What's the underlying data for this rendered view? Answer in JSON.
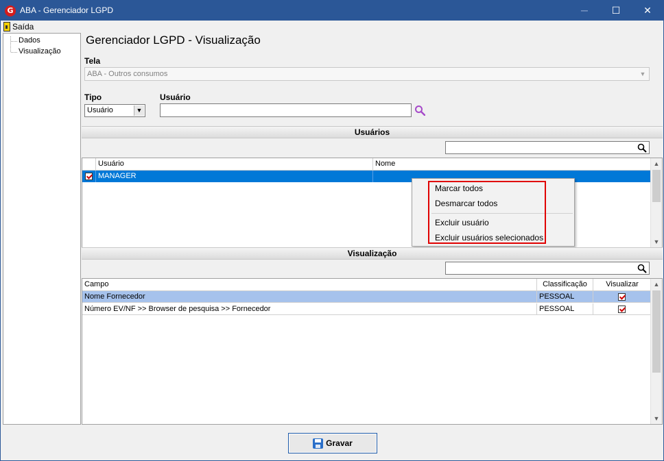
{
  "window": {
    "title": "ABA - Gerenciador LGPD",
    "app_icon_letter": "G",
    "min_glyph": "─",
    "max_glyph": "☐",
    "close_glyph": "✕"
  },
  "menu": {
    "exit_label": "Saída"
  },
  "tree": {
    "items": [
      {
        "label": "Dados"
      },
      {
        "label": "Visualização"
      }
    ]
  },
  "page": {
    "title": "Gerenciador LGPD - Visualização"
  },
  "form": {
    "tela_label": "Tela",
    "tela_value": "ABA - Outros consumos",
    "tipo_label": "Tipo",
    "tipo_value": "Usuário",
    "usuario_label": "Usuário",
    "usuario_value": ""
  },
  "users_section": {
    "header": "Usuários",
    "filter_value": "",
    "columns": [
      "",
      "Usuário",
      "Nome"
    ],
    "rows": [
      {
        "checked": true,
        "usuario": "MANAGER",
        "nome": ""
      }
    ]
  },
  "context_menu": {
    "items": [
      {
        "label": "Marcar todos"
      },
      {
        "label": "Desmarcar todos"
      },
      {
        "label": "Excluir usuário"
      },
      {
        "label": "Excluir usuários selecionados"
      }
    ],
    "highlight_color": "#e00000"
  },
  "view_section": {
    "header": "Visualização",
    "filter_value": "",
    "columns": [
      "Campo",
      "Classificação",
      "Visualizar"
    ],
    "rows": [
      {
        "campo": "Nome Fornecedor",
        "classificacao": "PESSOAL",
        "visualizar": true
      },
      {
        "campo": "Número  EV/NF >> Browser de pesquisa >> Fornecedor",
        "classificacao": "PESSOAL",
        "visualizar": true
      }
    ]
  },
  "footer": {
    "save_label": "Gravar"
  },
  "colors": {
    "titlebar": "#2b5797",
    "selection": "#0078d7",
    "selection_light": "#a6c2ec",
    "search_icon": "#a64ac9"
  },
  "icons": {
    "search": "magnifier-icon",
    "save": "floppy-icon",
    "exit": "door-exit-icon"
  }
}
